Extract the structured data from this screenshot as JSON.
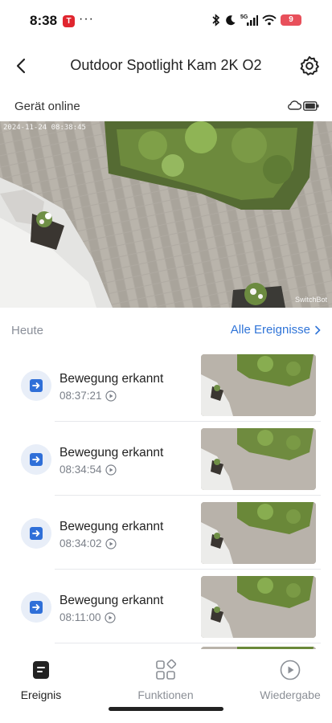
{
  "status_bar": {
    "time": "8:38",
    "app_badge": "T",
    "more": "···",
    "network": "5G",
    "battery": "9"
  },
  "header": {
    "title": "Outdoor Spotlight Kam 2K O2"
  },
  "device": {
    "status": "Gerät online"
  },
  "camera": {
    "timestamp": "2024-11-24 08:38:45",
    "watermark": "SwitchBot"
  },
  "events": {
    "section_label": "Heute",
    "all_label": "Alle Ereignisse",
    "items": [
      {
        "title": "Bewegung erkannt",
        "time": "08:37:21"
      },
      {
        "title": "Bewegung erkannt",
        "time": "08:34:54"
      },
      {
        "title": "Bewegung erkannt",
        "time": "08:34:02"
      },
      {
        "title": "Bewegung erkannt",
        "time": "08:11:00"
      }
    ]
  },
  "nav": {
    "items": [
      {
        "label": "Ereignis",
        "active": true
      },
      {
        "label": "Funktionen",
        "active": false
      },
      {
        "label": "Wiedergabe",
        "active": false
      }
    ]
  },
  "colors": {
    "accent": "#2f74d8",
    "event_icon": "#2f6fd8",
    "icon_bg": "#e8eef8",
    "muted_text": "#8a8f99"
  },
  "icons": {
    "back": "chevron-left-icon",
    "settings": "gear-icon",
    "cloud": "cloud-icon",
    "battery": "battery-icon",
    "chevron": "chevron-right-icon",
    "play": "play-circle-icon",
    "event": "motion-event-icon",
    "nav_event": "event-list-icon",
    "nav_functions": "functions-grid-icon",
    "nav_playback": "playback-icon"
  }
}
